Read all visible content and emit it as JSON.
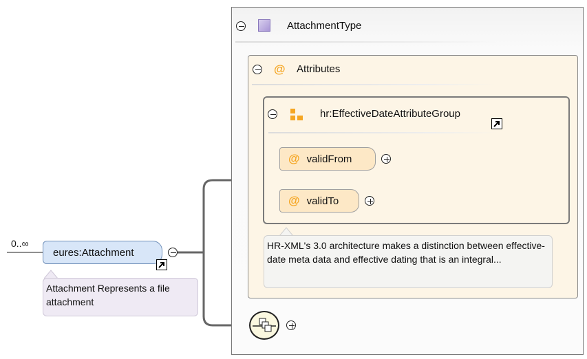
{
  "element": {
    "name": "eures:Attachment",
    "cardinality": "0..∞",
    "documentation": "Attachment Represents a file attachment"
  },
  "type": {
    "name": "AttachmentType"
  },
  "attributes": {
    "header": "Attributes",
    "group": {
      "name": "hr:EffectiveDateAttributeGroup",
      "items": [
        {
          "name": "validFrom"
        },
        {
          "name": "validTo"
        }
      ],
      "documentation": "HR-XML's 3.0 architecture makes a distinction between effective-date meta data and effective dating that is an integral..."
    }
  },
  "symbols": {
    "at": "@",
    "collapse": "⊖"
  },
  "colors": {
    "element_fill": "#d8e6f8",
    "attribute_fill": "#fde8c6",
    "panel_fill": "#fdf5e6",
    "at_symbol": "#f5a623",
    "group_icon": "#f5a623",
    "type_icon": "#b3a3dc"
  },
  "icons": {
    "type": "complex-type-icon",
    "attribute": "attribute-icon",
    "group": "attribute-group-icon",
    "link": "reference-link-icon",
    "sequence": "sequence-compositor-icon"
  }
}
